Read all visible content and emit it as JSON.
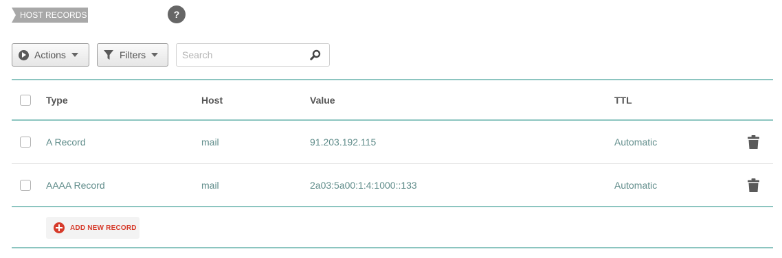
{
  "section": {
    "title": "HOST RECORDS",
    "help_label": "?"
  },
  "toolbar": {
    "actions_label": "Actions",
    "filters_label": "Filters",
    "search_placeholder": "Search",
    "search_value": ""
  },
  "table": {
    "columns": {
      "type": "Type",
      "host": "Host",
      "value": "Value",
      "ttl": "TTL"
    },
    "rows": [
      {
        "type": "A Record",
        "host": "mail",
        "value": "91.203.192.115",
        "ttl": "Automatic"
      },
      {
        "type": "AAAA Record",
        "host": "mail",
        "value": "2a03:5a00:1:4:1000::133",
        "ttl": "Automatic"
      }
    ]
  },
  "add_record": {
    "label": "ADD NEW RECORD"
  },
  "colors": {
    "accent_teal": "#8cc5c0",
    "link_teal": "#5f8c8a",
    "danger_red": "#d63a2a"
  }
}
